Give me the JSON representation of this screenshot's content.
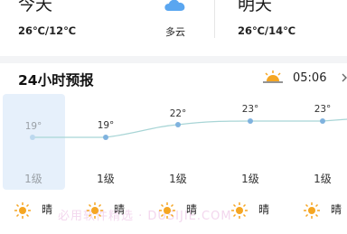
{
  "today": {
    "title": "今天",
    "temps": "26℃/12℃",
    "condition": "多云",
    "icon": "cloud-icon"
  },
  "tomorrow": {
    "title": "明天",
    "temps": "26℃/14℃"
  },
  "hourly": {
    "title": "24小时预报",
    "sunrise_icon": "sunrise-icon",
    "sunrise_time": "05:06",
    "chevron_icon": "chevron-right-icon",
    "temps": [
      "19°",
      "19°",
      "22°",
      "23°",
      "23°"
    ],
    "winds": [
      "1级",
      "1级",
      "1级",
      "1级",
      "1级"
    ],
    "conditions": [
      "晴",
      "晴",
      "晴",
      "晴",
      "晴"
    ],
    "condition_icon": "sun-icon"
  },
  "watermark": "必用软件精选 · DUSIJIE.COM",
  "colors": {
    "accent_highlight": "#e6f0fb",
    "curve": "#a8d5d6",
    "sun": "#f5a623",
    "cloud": "#5aa6f0"
  }
}
